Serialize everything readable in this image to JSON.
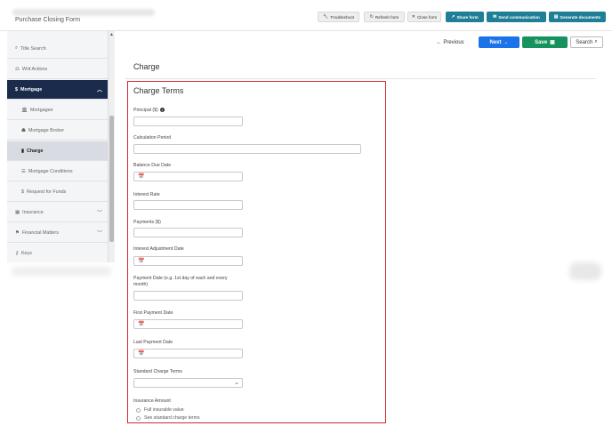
{
  "header": {
    "form_title": "Purchase Closing Form",
    "buttons": {
      "troubleshoot": "Troubleshoot",
      "refresh": "Refresh form",
      "close": "Close form",
      "share": "Share form",
      "send": "Send communication",
      "generate": "Generate documents"
    }
  },
  "sidebar": {
    "items": {
      "title_search": "Title Search",
      "writ_actions": "Writ Actions",
      "mortgage": "Mortgage",
      "mortgagee": "Mortgagee",
      "mortgage_broker": "Mortgage Broker",
      "charge": "Charge",
      "mortgage_conditions": "Mortgage Conditions",
      "request_for_funds": "Request for Funds",
      "insurance": "Insurance",
      "financial_matters": "Financial Matters",
      "keys": "Keys"
    }
  },
  "nav": {
    "previous": "Previous",
    "next": "Next",
    "save": "Save",
    "search": "Search"
  },
  "main": {
    "section_title": "Charge",
    "terms_title": "Charge Terms",
    "fields": {
      "principal": "Principal ($)",
      "calculation_period": "Calculation Period",
      "balance_due_date": "Balance Due Date",
      "interest_rate": "Interest Rate",
      "payments": "Payments ($)",
      "interest_adjustment_date": "Interest Adjustment Date",
      "payment_date_line1": "Payment Date (e.g. 1st day of each and every",
      "payment_date_line2": "month)",
      "first_payment_date": "First Payment Date",
      "last_payment_date": "Last Payment Date",
      "standard_charge_terms": "Standard Charge Terms",
      "insurance_amount": "Insurance Amount"
    },
    "insurance_options": {
      "full": "Full insurable value",
      "see": "See standard charge terms"
    }
  },
  "colors": {
    "sidebar_active_parent": "#1a2b4c",
    "toolbar_teal": "#1f7f96",
    "next_blue": "#1a73e8",
    "save_green": "#16925f",
    "highlight_red": "#d7262e"
  }
}
